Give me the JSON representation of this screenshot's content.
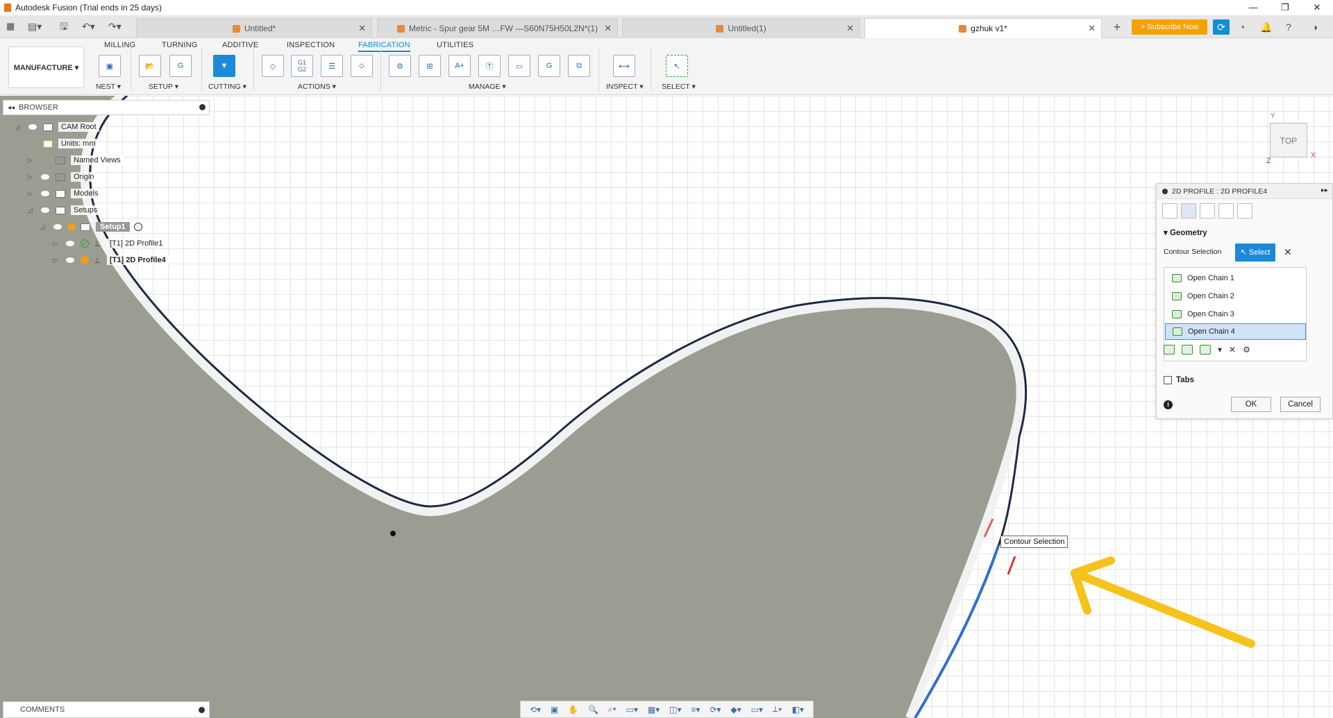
{
  "window": {
    "title": "Autodesk Fusion (Trial ends in 25 days)",
    "controls": [
      "—",
      "❐",
      "✕"
    ]
  },
  "doc_tabs": [
    {
      "label": "Untitled*"
    },
    {
      "label": "Metric - Spur gear 5M …FW —S60N75H50L2N*(1)"
    },
    {
      "label": "Untitled(1)"
    },
    {
      "label": "gzhuk v1*"
    }
  ],
  "header": {
    "subscribe": "+ Subscribe Now"
  },
  "ribbon": {
    "workspace": "MANUFACTURE ▾",
    "tabs": [
      "MILLING",
      "TURNING",
      "ADDITIVE",
      "INSPECTION",
      "FABRICATION",
      "UTILITIES"
    ],
    "groups": [
      "NEST ▾",
      "SETUP ▾",
      "CUTTING ▾",
      "ACTIONS ▾",
      "MANAGE ▾",
      "INSPECT ▾",
      "SELECT ▾"
    ],
    "g1g2": "G1\nG2"
  },
  "browser": {
    "title": "BROWSER",
    "items": [
      {
        "label": "CAM Root"
      },
      {
        "label": "Units: mm"
      },
      {
        "label": "Named Views"
      },
      {
        "label": "Origin"
      },
      {
        "label": "Models"
      },
      {
        "label": "Setups"
      },
      {
        "label": "Setup1"
      },
      {
        "label": "[T1] 2D Profile1"
      },
      {
        "label": "[T1] 2D Profile4"
      }
    ]
  },
  "panel": {
    "title": "2D PROFILE : 2D PROFILE4",
    "geometry_heading": "Geometry",
    "contour_selection_label": "Contour Selection",
    "select_button": "Select",
    "chains": [
      "Open Chain 1",
      "Open Chain 2",
      "Open Chain 3",
      "Open Chain 4"
    ],
    "tabs_label": "Tabs",
    "ok": "OK",
    "cancel": "Cancel"
  },
  "viewport": {
    "tooltip": "Contour Selection",
    "viewcube_label": "TOP",
    "axis_x": "X",
    "axis_y": "Y",
    "axis_z": "Z"
  },
  "comments": {
    "title": "COMMENTS"
  },
  "colors": {
    "accent": "#1a8ad8",
    "subscribe": "#f5a100",
    "part_fill": "#9a9d91",
    "annotation_arrow": "#f6c31c",
    "selected_chain": "#2f6fd0"
  }
}
